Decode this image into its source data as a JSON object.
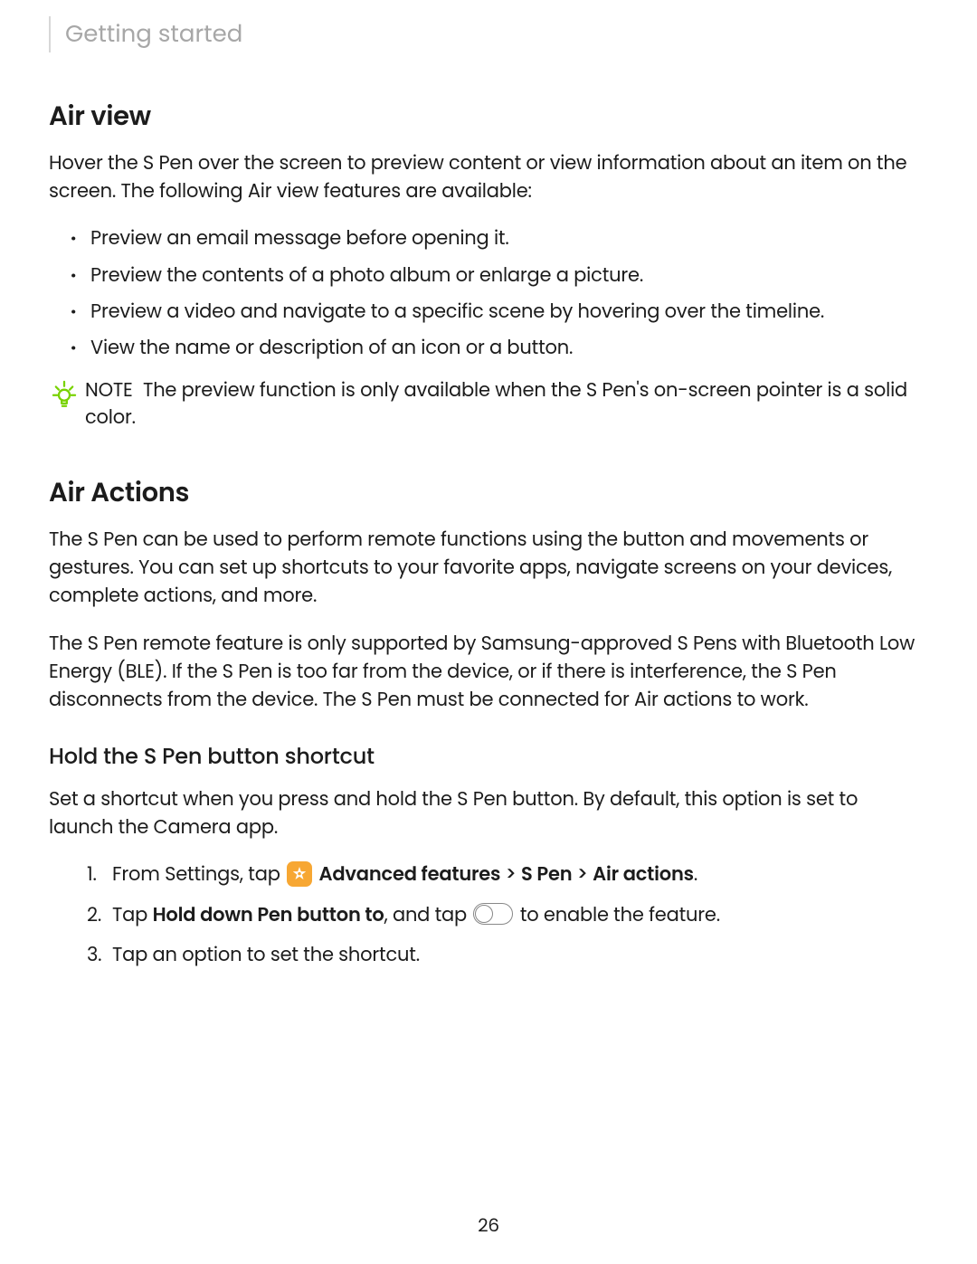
{
  "section_header": "Getting started",
  "air_view": {
    "heading": "Air view",
    "intro": "Hover the S Pen over the screen to preview content or view information about an item on the screen. The following Air view features are available:",
    "bullets": [
      "Preview an email message before opening it.",
      "Preview the contents of a photo album or enlarge a picture.",
      "Preview a video and navigate to a specific scene by hovering over the timeline.",
      "View the name or description of an icon or a button."
    ],
    "note_label": "NOTE",
    "note_text": "The preview function is only available when the S Pen's on-screen pointer is a solid color."
  },
  "air_actions": {
    "heading": "Air Actions",
    "p1": "The S Pen can be used to perform remote functions using the button and movements or gestures. You can set up shortcuts to your favorite apps, navigate screens on your devices, complete actions, and more.",
    "p2": "The S Pen remote feature is only supported by Samsung-approved S Pens with Bluetooth Low Energy (BLE). If the S Pen is too far from the device, or if there is interference, the S Pen disconnects from the device. The S Pen must be connected for Air actions to work.",
    "sub_heading": "Hold the S Pen button shortcut",
    "sub_intro": "Set a shortcut when you press and hold the S Pen button. By default, this option is set to launch the Camera app.",
    "step1_prefix": "From Settings, tap ",
    "step1_b1": "Advanced features",
    "step1_sep": " > ",
    "step1_b2": "S Pen",
    "step1_b3": "Air actions",
    "step1_suffix": ".",
    "step2_prefix": "Tap ",
    "step2_b1": "Hold down Pen button to",
    "step2_mid": ", and tap ",
    "step2_suffix": " to enable the feature.",
    "step3": "Tap an option to set the shortcut."
  },
  "page_number": "26"
}
